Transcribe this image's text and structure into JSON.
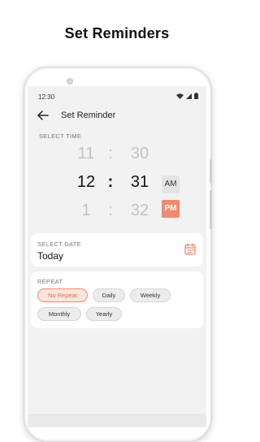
{
  "promo": {
    "title": "Set Reminders"
  },
  "status_bar": {
    "time": "12:30"
  },
  "app_bar": {
    "title": "Set Reminder",
    "back_icon": "arrow-left-icon"
  },
  "time_picker": {
    "label": "SELECT TIME",
    "rows": [
      {
        "hour": "11",
        "minute": "30",
        "state": "faded"
      },
      {
        "hour": "12",
        "minute": "31",
        "state": "selected"
      },
      {
        "hour": "1",
        "minute": "32",
        "state": "faded"
      }
    ],
    "separator": ":",
    "am_label": "AM",
    "pm_label": "PM",
    "selected_period": "PM"
  },
  "date": {
    "label": "SELECT DATE",
    "value": "Today",
    "icon": "calendar-icon"
  },
  "repeat": {
    "label": "REPEAT",
    "options": [
      "No Repeat",
      "Daily",
      "Weekly",
      "Monthly",
      "Yearly"
    ],
    "selected": "No Repeat"
  },
  "colors": {
    "accent": "#f08a70",
    "accent_light": "#fde4dc",
    "screen_bg": "#f2f2f2"
  }
}
